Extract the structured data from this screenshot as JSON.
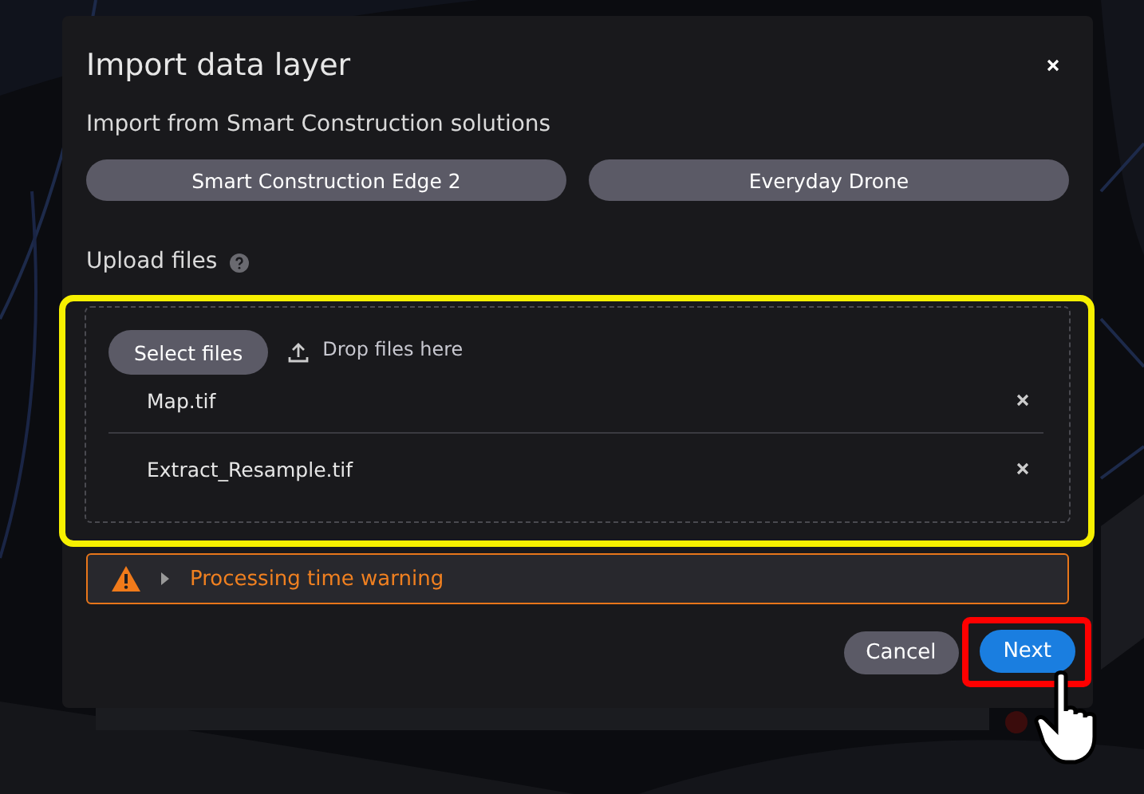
{
  "dialog": {
    "title": "Import data layer",
    "subtitle": "Import from Smart Construction solutions",
    "sources": [
      {
        "label": "Smart Construction Edge 2"
      },
      {
        "label": "Everyday Drone"
      }
    ],
    "upload": {
      "label": "Upload files",
      "select_button": "Select files",
      "drop_hint": "Drop files here",
      "files": [
        {
          "name": "Map.tif"
        },
        {
          "name": "Extract_Resample.tif"
        }
      ]
    },
    "warning": {
      "text": "Processing time warning",
      "expanded": false
    },
    "buttons": [
      {
        "label": "Cancel",
        "kind": "secondary"
      },
      {
        "label": "Next",
        "kind": "primary"
      }
    ]
  }
}
